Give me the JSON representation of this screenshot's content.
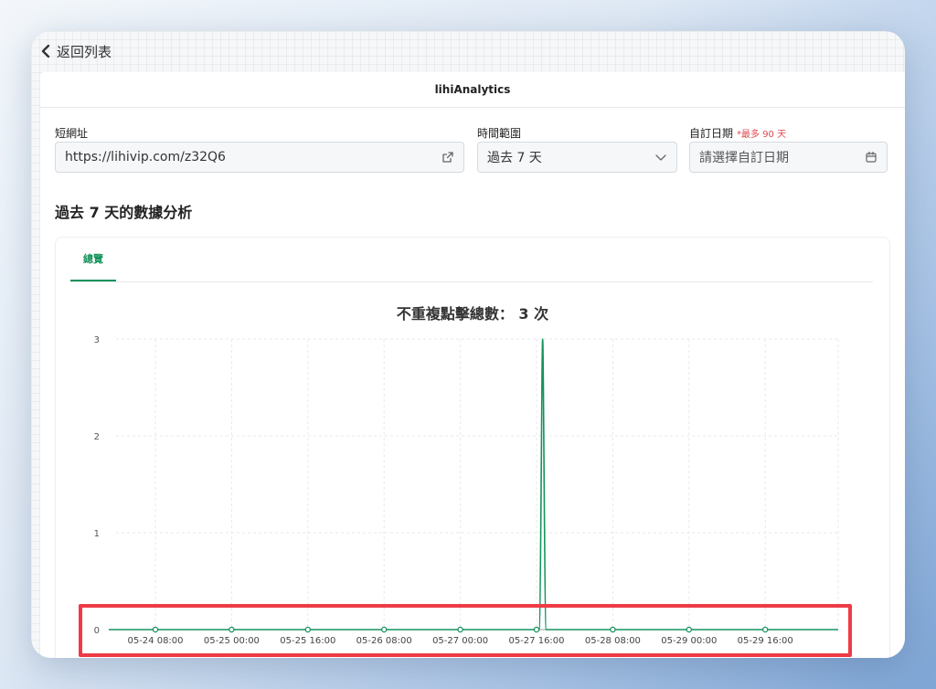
{
  "nav": {
    "back_label": "返回列表"
  },
  "header": {
    "title": "lihiAnalytics"
  },
  "form": {
    "short_url": {
      "label": "短網址",
      "value": "https://lihivip.com/z32Q6"
    },
    "time_range": {
      "label": "時間範圍",
      "value": "過去 7 天"
    },
    "custom_date": {
      "label": "自訂日期",
      "note": "*最多 90 天",
      "placeholder": "請選擇自訂日期"
    }
  },
  "section": {
    "title": "過去 7 天的數據分析"
  },
  "tabs": [
    {
      "label": "總覽",
      "active": true
    }
  ],
  "colors": {
    "accent": "#15935b",
    "highlight": "#ee3b46"
  },
  "chart_data": {
    "type": "line",
    "title": "不重複點擊總數： 3 次",
    "xlabel": "",
    "ylabel": "",
    "ylim": [
      0,
      3
    ],
    "yticks": [
      0,
      1,
      2,
      3
    ],
    "grid": true,
    "x_ticks": [
      "05-24 08:00",
      "05-25 00:00",
      "05-25 16:00",
      "05-26 08:00",
      "05-27 00:00",
      "05-27 16:00",
      "05-28 08:00",
      "05-29 00:00",
      "05-29 16:00"
    ],
    "series": [
      {
        "values": [
          0,
          0,
          0,
          0,
          0,
          0,
          0,
          0,
          0
        ],
        "peak": {
          "between": [
            "05-27 16:00",
            "05-28 08:00"
          ],
          "value": 3
        }
      }
    ]
  }
}
